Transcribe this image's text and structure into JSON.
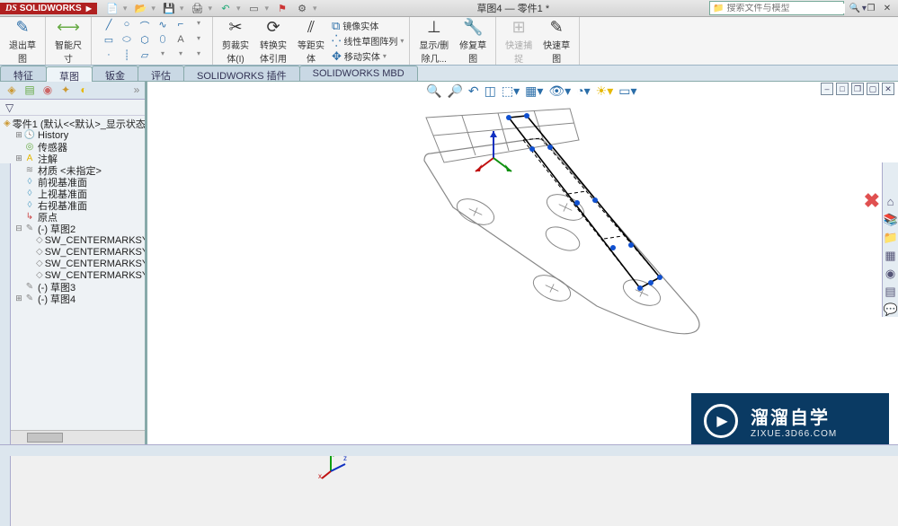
{
  "app_name": "SOLIDWORKS",
  "title": "草图4 — 零件1 *",
  "search_placeholder": "搜索文件与模型",
  "tabs": [
    "特征",
    "草图",
    "钣金",
    "评估",
    "SOLIDWORKS 插件",
    "SOLIDWORKS MBD"
  ],
  "active_tab_index": 1,
  "ribbon": {
    "exit_sketch": "退出草\n图",
    "smart_dim": "智能尺\n寸",
    "trim": "剪裁实\n体(I)",
    "convert": "转换实\n体引用",
    "offset": "等距实\n体",
    "mirror": "镜像实体",
    "pattern": "线性草图阵列",
    "move": "移动实体",
    "display": "显示/删\n除几...",
    "repair": "修复草\n图",
    "snap": "快速捕\n捉",
    "quick": "快速草\n图"
  },
  "tree": {
    "root": "零件1 (默认<<默认>_显示状态",
    "history": "History",
    "sensors": "传感器",
    "annotations": "注解",
    "material": "材质 <未指定>",
    "front_plane": "前视基准面",
    "top_plane": "上视基准面",
    "right_plane": "右视基准面",
    "origin": "原点",
    "sketch2": "(-) 草图2",
    "centermark": "SW_CENTERMARKSYM",
    "sketch3": "(-) 草图3",
    "sketch4": "(-) 草图4"
  },
  "watermark": {
    "main": "溜溜自学",
    "sub": "ZIXUE.3D66.COM"
  }
}
